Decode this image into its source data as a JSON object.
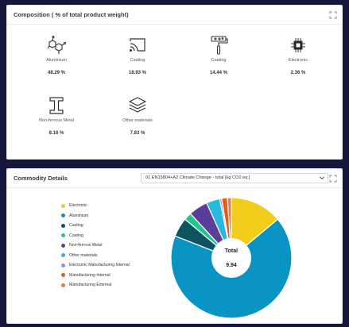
{
  "composition": {
    "title": "Composition ( % of total product weight)",
    "items": [
      {
        "label": "Aluminium",
        "value": "48.29 %",
        "icon": "molecule-icon"
      },
      {
        "label": "Casting",
        "value": "18.93 %",
        "icon": "cast-icon"
      },
      {
        "label": "Coating",
        "value": "14.44 %",
        "icon": "paint-roller-icon"
      },
      {
        "label": "Electronic",
        "value": "2.36 %",
        "icon": "chip-icon"
      },
      {
        "label": "Non-ferrous Metal",
        "value": "8.16 %",
        "icon": "i-beam-icon"
      },
      {
        "label": "Other materials",
        "value": "7.83 %",
        "icon": "layers-icon"
      }
    ]
  },
  "commodity": {
    "title": "Commodity Details",
    "select_value": "01 EN15804+A2 Climate Change - total [kg CO2 eq.]",
    "center_label": "Total",
    "center_value": "9.94",
    "legend": [
      {
        "label": "Electronic",
        "color": "#f2cd1c"
      },
      {
        "label": "Aluminium",
        "color": "#0a94c4"
      },
      {
        "label": "Casting",
        "color": "#0e5460"
      },
      {
        "label": "Coating",
        "color": "#22c68a"
      },
      {
        "label": "Non-ferrous Metal",
        "color": "#5b3e9a"
      },
      {
        "label": "Other materials",
        "color": "#29b8e0"
      },
      {
        "label": "Electronic Manufacturing Internal",
        "color": "#a58ad8"
      },
      {
        "label": "Manufacturing Internal",
        "color": "#ec5a15"
      },
      {
        "label": "Manufacturing External",
        "color": "#e07c47"
      }
    ]
  },
  "chart_data": {
    "type": "pie",
    "categories": [
      "Electronic",
      "Aluminium",
      "Casting",
      "Coating",
      "Non-ferrous Metal",
      "Other materials",
      "Electronic Manufacturing Internal",
      "Manufacturing Internal",
      "Manufacturing External"
    ],
    "values": [
      13.5,
      65.0,
      5.0,
      2.0,
      5.0,
      3.5,
      0.5,
      1.5,
      1.0
    ],
    "colors": [
      "#f2cd1c",
      "#0a94c4",
      "#0e5460",
      "#22c68a",
      "#5b3e9a",
      "#29b8e0",
      "#a58ad8",
      "#ec5a15",
      "#e07c47"
    ],
    "total_label": "Total",
    "total_value": "9.94",
    "legend_position": "left"
  }
}
